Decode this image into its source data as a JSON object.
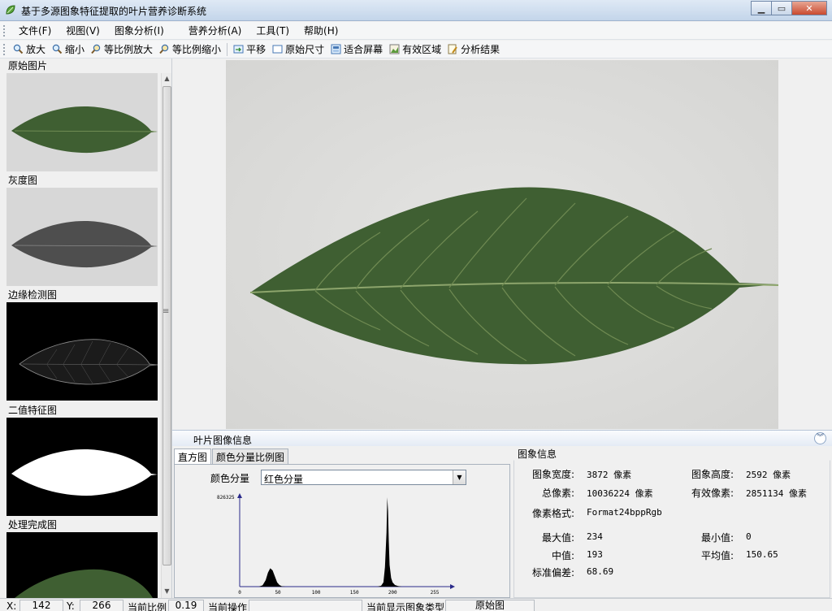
{
  "window": {
    "title": "基于多源图象特征提取的叶片营养诊断系统",
    "icon": "leaf-app-icon"
  },
  "menu": [
    "文件(F)",
    "视图(V)",
    "图象分析(I)",
    "营养分析(A)",
    "工具(T)",
    "帮助(H)"
  ],
  "toolbar": [
    {
      "label": "放大",
      "icon": "zoom-in-icon"
    },
    {
      "label": "缩小",
      "icon": "zoom-out-icon"
    },
    {
      "label": "等比例放大",
      "icon": "proportional-zoom-in-icon"
    },
    {
      "label": "等比例缩小",
      "icon": "proportional-zoom-out-icon"
    },
    {
      "label": "平移",
      "icon": "pan-icon"
    },
    {
      "label": "原始尺寸",
      "icon": "original-size-icon"
    },
    {
      "label": "适合屏幕",
      "icon": "fit-screen-icon"
    },
    {
      "label": "有效区域",
      "icon": "valid-region-icon"
    },
    {
      "label": "分析结果",
      "icon": "analysis-result-icon"
    }
  ],
  "thumbnails": [
    {
      "label": "原始图片",
      "kind": "original"
    },
    {
      "label": "灰度图",
      "kind": "gray"
    },
    {
      "label": "边缘检测图",
      "kind": "edge"
    },
    {
      "label": "二值特征图",
      "kind": "binary"
    },
    {
      "label": "处理完成图",
      "kind": "processed"
    }
  ],
  "info_panel": {
    "title": "叶片图像信息",
    "tabs": [
      "直方图",
      "颜色分量比例图"
    ],
    "active_tab": 0,
    "channel_label": "颜色分量",
    "channel_value": "红色分量"
  },
  "chart_data": {
    "type": "area",
    "title": "",
    "xlabel": "",
    "ylabel": "",
    "xlim": [
      0,
      255
    ],
    "ylim": [
      0,
      826325
    ],
    "x_ticks": [
      "0",
      "50",
      "100",
      "150",
      "200",
      "255"
    ],
    "y_max_label": "826325",
    "series": [
      {
        "x": [
          0,
          25,
          30,
          34,
          37,
          40,
          43,
          46,
          49,
          52,
          55,
          60,
          100,
          180,
          185,
          188,
          190,
          192,
          193,
          194,
          195,
          196,
          198,
          200,
          203,
          207,
          212,
          255
        ],
        "values": [
          0,
          0,
          12000,
          60000,
          130000,
          170000,
          150000,
          95000,
          40000,
          15000,
          4000,
          0,
          0,
          0,
          8000,
          40000,
          180000,
          500000,
          826325,
          700000,
          420000,
          200000,
          80000,
          40000,
          15000,
          6000,
          0,
          0
        ]
      }
    ],
    "colors": {
      "fill": "#000000"
    }
  },
  "image_info": {
    "title": "图象信息",
    "fields": [
      {
        "key": "图象宽度:",
        "value": "3872 像素"
      },
      {
        "key": "图象高度:",
        "value": "2592 像素"
      },
      {
        "key": "总像素:",
        "value": "10036224 像素"
      },
      {
        "key": "有效像素:",
        "value": "2851134 像素"
      },
      {
        "key": "像素格式:",
        "value": "Format24bppRgb"
      },
      {
        "key": "最大值:",
        "value": "234"
      },
      {
        "key": "最小值:",
        "value": "0"
      },
      {
        "key": "中值:",
        "value": "193"
      },
      {
        "key": "平均值:",
        "value": "150.65"
      },
      {
        "key": "标准偏差:",
        "value": "68.69"
      }
    ]
  },
  "status": {
    "x_label": "X:",
    "x_value": "142",
    "y_label": "Y:",
    "y_value": "266",
    "scale_label": "当前比例",
    "scale_value": "0.19",
    "op_label": "当前操作",
    "op_value": "",
    "type_label": "当前显示图象类型",
    "type_value": "原始图"
  },
  "colors": {
    "leaf": "#3f5f32",
    "leaf_vein": "#7f9a5e",
    "background_gray": "#d9d9d9"
  }
}
